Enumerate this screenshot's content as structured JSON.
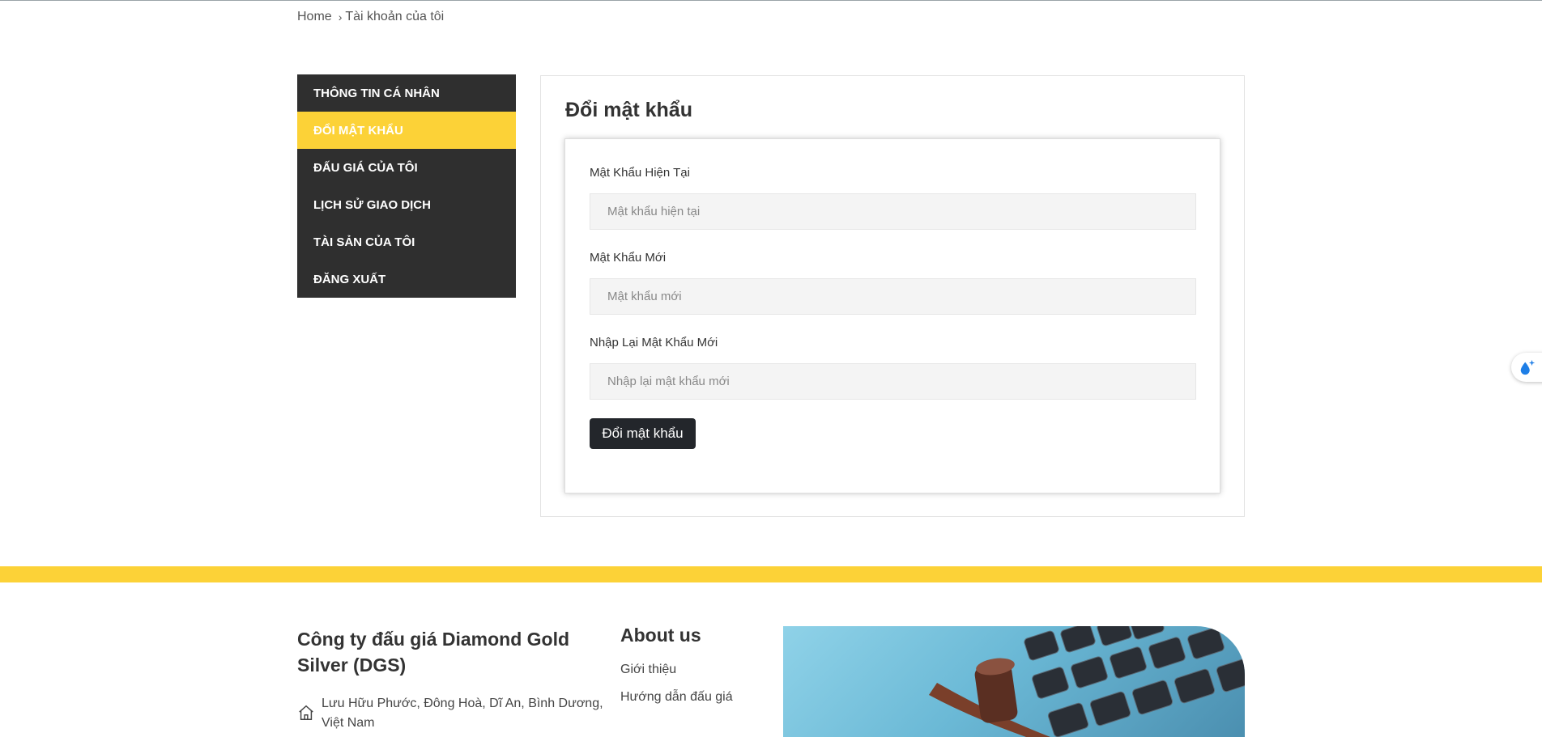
{
  "breadcrumb": {
    "home": "Home",
    "separator": "›",
    "current": "Tài khoản của tôi"
  },
  "sidebar": {
    "items": [
      {
        "label": "THÔNG TIN CÁ NHÂN",
        "active": false
      },
      {
        "label": "ĐỔI MẬT KHẨU",
        "active": true
      },
      {
        "label": "ĐẤU GIÁ CỦA TÔI",
        "active": false
      },
      {
        "label": "LỊCH SỬ GIAO DỊCH",
        "active": false
      },
      {
        "label": "TÀI SẢN CỦA TÔI",
        "active": false
      },
      {
        "label": "ĐĂNG XUẤT",
        "active": false
      }
    ]
  },
  "main": {
    "title": "Đổi mật khẩu",
    "fields": [
      {
        "label": "Mật Khẩu Hiện Tại",
        "placeholder": "Mật khẩu hiện tại",
        "value": ""
      },
      {
        "label": "Mật Khẩu Mới",
        "placeholder": "Mật khẩu mới",
        "value": ""
      },
      {
        "label": "Nhập Lại Mật Khẩu Mới",
        "placeholder": "Nhập lại mật khẩu mới",
        "value": ""
      }
    ],
    "submit_label": "Đổi mật khẩu"
  },
  "footer": {
    "company_name": "Công ty đấu giá Diamond Gold Silver (DGS)",
    "address": "Lưu Hữu Phước, Đông Hoà, Dĩ An, Bình Dương, Việt Nam",
    "about": {
      "title": "About us",
      "links": [
        "Giới thiệu",
        "Hướng dẫn đấu giá"
      ]
    },
    "image_icon": "auction-gavel-keyboard-image"
  },
  "floating_widget": {
    "icon": "sparkle-drop-icon"
  },
  "colors": {
    "accent": "#fcd237",
    "sidebar_bg": "#2f2f2f",
    "button_bg": "#23262b",
    "input_bg": "#f4f4f4"
  }
}
